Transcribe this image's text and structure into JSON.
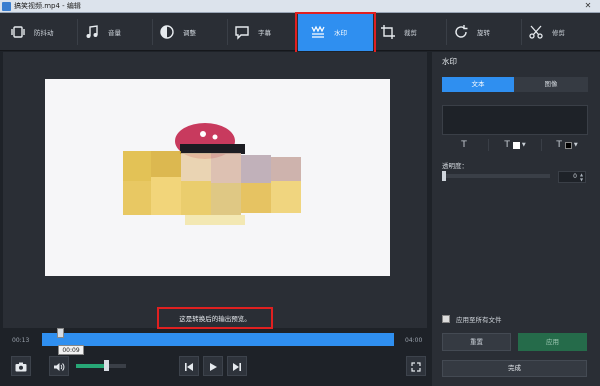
{
  "window": {
    "title": "搞笑视频.mp4 - 编辑",
    "close_glyph": "✕"
  },
  "toolbar": {
    "items": [
      {
        "label": "防抖动",
        "icon": "stabilize-icon"
      },
      {
        "label": "音量",
        "icon": "music-note-icon"
      },
      {
        "label": "调整",
        "icon": "contrast-icon"
      },
      {
        "label": "字幕",
        "icon": "speech-bubble-icon"
      },
      {
        "label": "水印",
        "icon": "watermark-icon",
        "active": true
      },
      {
        "label": "裁剪",
        "icon": "crop-icon"
      },
      {
        "label": "旋转",
        "icon": "rotate-icon"
      },
      {
        "label": "修剪",
        "icon": "scissors-icon"
      }
    ]
  },
  "preview": {
    "tip": "这是转换后的输出预览。"
  },
  "timeline": {
    "start": "00:13",
    "end": "04:00",
    "current": "00:09"
  },
  "controls": {
    "icons": [
      "camera-icon",
      "speaker-icon",
      "prev-frame-icon",
      "play-icon",
      "next-frame-icon",
      "fullscreen-icon"
    ],
    "volume_level": 0.6
  },
  "panel": {
    "title": "水印",
    "tabs": [
      "文本",
      "图像"
    ],
    "format_glyphs": [
      "T",
      "T",
      "T"
    ],
    "opacity_label": "透明度：",
    "opacity_value": "0",
    "apply_all_label": "应用至所有文件",
    "reset_label": "重置",
    "apply_label": "应用",
    "done_label": "完成"
  },
  "colors": {
    "accent": "#2f8ff0",
    "highlight_box": "#e02020",
    "apply": "#256b4a"
  }
}
